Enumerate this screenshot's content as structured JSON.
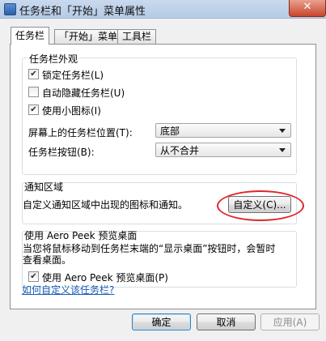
{
  "window": {
    "title": "任务栏和「开始」菜单属性",
    "close_glyph": "✕"
  },
  "tabs": [
    {
      "label": "任务栏",
      "active": true
    },
    {
      "label": "「开始」菜单",
      "active": false
    },
    {
      "label": "工具栏",
      "active": false
    }
  ],
  "appearance": {
    "legend": "任务栏外观",
    "lock_taskbar": {
      "label": "锁定任务栏(L)",
      "checked": true
    },
    "auto_hide": {
      "label": "自动隐藏任务栏(U)",
      "checked": false
    },
    "small_icons": {
      "label": "使用小图标(I)",
      "checked": true
    },
    "position_label": "屏幕上的任务栏位置(T):",
    "position_value": "底部",
    "buttons_label": "任务栏按钮(B):",
    "buttons_value": "从不合并"
  },
  "notification": {
    "legend": "通知区域",
    "description": "自定义通知区域中出现的图标和通知。",
    "customize_button": "自定义(C)..."
  },
  "aero_peek": {
    "legend": "使用 Aero Peek 预览桌面",
    "description_line1": "当您将鼠标移动到任务栏末端的“显示桌面”按钮时，会暂时",
    "description_line2": "查看桌面。",
    "checkbox": {
      "label": "使用 Aero Peek 预览桌面(P)",
      "checked": true
    }
  },
  "help_link": "如何自定义该任务栏?",
  "footer": {
    "ok": "确定",
    "cancel": "取消",
    "apply": "应用(A)"
  },
  "colors": {
    "highlight_ring": "#e0262b",
    "link": "#1a5bb5"
  }
}
